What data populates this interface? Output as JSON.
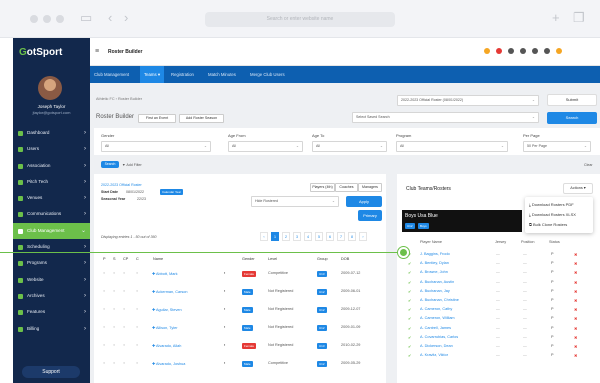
{
  "browser": {
    "address": "Search or enter website name"
  },
  "sidebar": {
    "logo_prefix": "G",
    "logo_text": "otSport",
    "user_name": "Joseph Taylor",
    "user_email": "jtaylor@gotsport.com",
    "items": [
      {
        "label": "Dashboard"
      },
      {
        "label": "Users"
      },
      {
        "label": "Association"
      },
      {
        "label": "Pitch Tech"
      },
      {
        "label": "Venues"
      },
      {
        "label": "Communications"
      },
      {
        "label": "Club Management"
      },
      {
        "label": "Scheduling"
      },
      {
        "label": "Programs"
      },
      {
        "label": "Website"
      },
      {
        "label": "Archives"
      },
      {
        "label": "Features"
      },
      {
        "label": "Billing"
      }
    ],
    "support_label": "Support"
  },
  "topbar": {
    "title": "Roster Builder"
  },
  "tabs": [
    {
      "label": "Club Management"
    },
    {
      "label": "Teams ▾"
    },
    {
      "label": "Registration"
    },
    {
      "label": "Match Minutes"
    },
    {
      "label": "Merge Club Users"
    }
  ],
  "page": {
    "breadcrumb": "Athletic FC  ›  Roster Builder",
    "title": "Roster Builder",
    "first_event_btn": "First an Event",
    "add_roster_btn": "Add Roster Season",
    "roster_select": "2022-2023 Official Roster (08/01/2022)",
    "season_select": "Select Saved Search",
    "submit": "Submit",
    "search": "Search",
    "filters": [
      {
        "label": "Gender",
        "value": "All"
      },
      {
        "label": "Age From",
        "value": "All"
      },
      {
        "label": "Age To",
        "value": "All"
      },
      {
        "label": "Program",
        "value": "All"
      },
      {
        "label": "Per Page",
        "value": "50 Per Page"
      }
    ],
    "search_small": "Search",
    "add_filter": "▼ Add Filter",
    "clear": "Clear"
  },
  "left_card": {
    "roster_name": "2022-2023 Official Roster",
    "start_date_label": "Start Date",
    "start_date": "08/01/2022",
    "calendar_year": "Calendar Year",
    "seasonal_label": "Seasonal Year",
    "seasonal_value": "22/23",
    "toggle": [
      "Players (4th)",
      "Coaches",
      "Managers"
    ],
    "hide_rostered": "Hide Rostered",
    "apply": "Apply",
    "primary": "Primary",
    "showing": "Displaying entries 1 - 50 out of 360",
    "pages": [
      "‹",
      "1",
      "2",
      "3",
      "4",
      "5",
      "6",
      "7",
      "8",
      "›"
    ],
    "headers": [
      "P",
      "S",
      "CP",
      "C",
      "Name",
      "Gender",
      "Level",
      "Group",
      "DOB"
    ],
    "rows": [
      {
        "name": "Abbott, Mark",
        "gender": "Female",
        "level": "Competitive",
        "group": "U13",
        "dob": "2009-07-12"
      },
      {
        "name": "Ackerman, Carson",
        "gender": "Male",
        "level": "Not Registered",
        "group": "U12",
        "dob": "2009-06-01"
      },
      {
        "name": "Aguilar, Steven",
        "gender": "Male",
        "level": "Not Registered",
        "group": "U12",
        "dob": "2009-12-07"
      },
      {
        "name": "Allison, Tyler",
        "gender": "Male",
        "level": "Not Registered",
        "group": "U12",
        "dob": "2009-01-09"
      },
      {
        "name": "Alvarado, Allah",
        "gender": "Female",
        "level": "Not Registered",
        "group": "U13",
        "dob": "2010-02-29"
      },
      {
        "name": "Alvarado, Joshua",
        "gender": "Male",
        "level": "Competitive",
        "group": "U12",
        "dob": "2009-05-29"
      }
    ]
  },
  "right_card": {
    "title": "Club Teams/Rosters",
    "actions": "Actions ▾",
    "team_name": "Boys Usa Blue",
    "team_tags": [
      "U12",
      "Boys"
    ],
    "menu": [
      "Download Rosters PDF",
      "Download Rosters XLSX",
      "Bulk Clone Rosters"
    ],
    "headers": [
      "Player Name",
      "Jersey",
      "Position",
      "Status"
    ],
    "players": [
      "J. Baggins, Frodo",
      "A. Bentley, Dylan",
      "A. Browne, John",
      "A. Buchanan, Austin",
      "A. Buchanan, Jay",
      "A. Buchanan, Christine",
      "A. Cameron, Cathy",
      "A. Cameron, William",
      "A. Cantrell, James",
      "A. Covarrubias, Carlos",
      "A. Dickerson, Dean",
      "A. Kravitz, Viktor"
    ],
    "dash": "—",
    "status": "P"
  }
}
